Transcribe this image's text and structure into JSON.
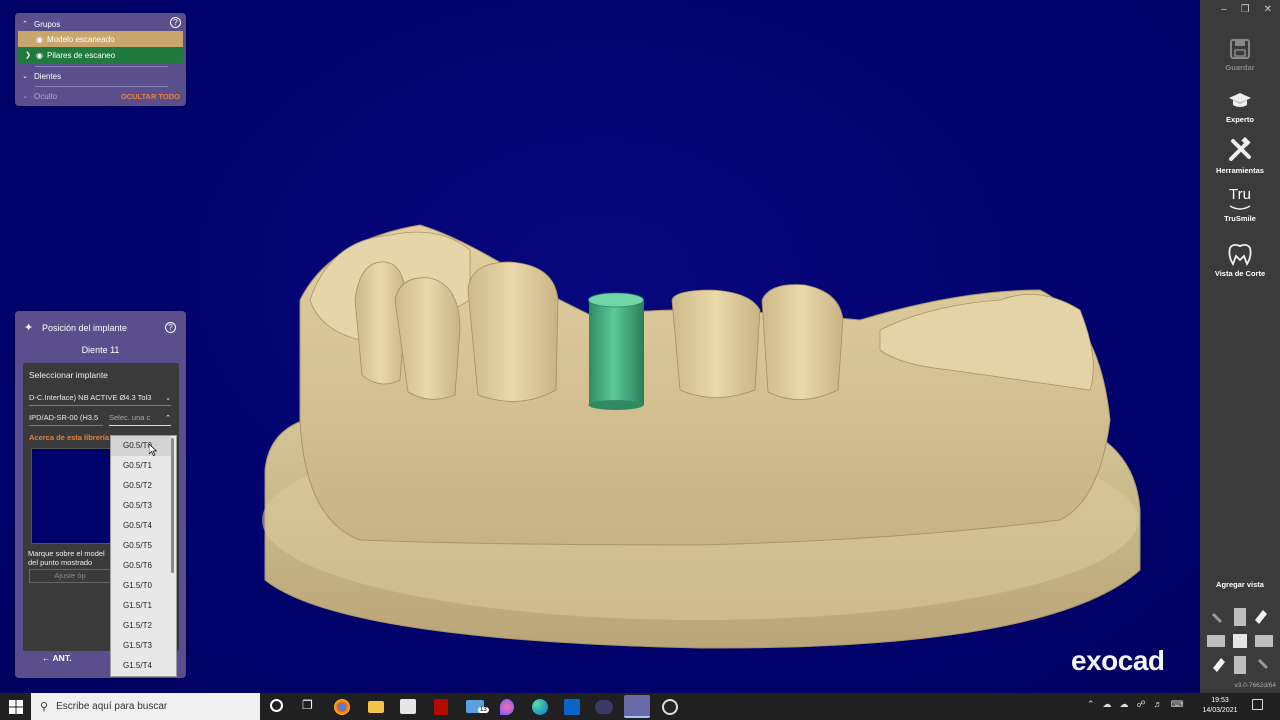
{
  "groups_panel": {
    "title": "Grupos",
    "items": [
      {
        "label": "Modelo escaneado",
        "color": "#c9a66b"
      },
      {
        "label": "Pilares de escaneo",
        "color": "#1f7a3e"
      }
    ],
    "teeth_label": "Dientes",
    "hidden_label": "Oculto",
    "hide_all_label": "OCULTAR TODO"
  },
  "implant_panel": {
    "title": "Posición del implante",
    "tooth": "Diente 11",
    "select_implant_label": "Seleccionar implante",
    "library_value": "D-C.Interface) NB ACTIVE Ø4.3 Tol3",
    "abutment_value": "IPD/AD-SR-00 (H3.5",
    "selection_placeholder": "Selec. una c",
    "about_link": "Acerca de esta librería",
    "instruction_line1": "Marque sobre el model",
    "instruction_line2": "del punto mostrado",
    "adjust_button": "Ajuste óp",
    "back_button": "ANT."
  },
  "dropdown": {
    "options": [
      "G0.5/T0",
      "G0.5/T1",
      "G0.5/T2",
      "G0.5/T3",
      "G0.5/T4",
      "G0.5/T5",
      "G0.5/T6",
      "G1.5/T0",
      "G1.5/T1",
      "G1.5/T2",
      "G1.5/T3",
      "G1.5/T4"
    ],
    "hovered_index": 0
  },
  "toolbar": {
    "save": "Guardar",
    "expert": "Experto",
    "tools": "Herramientas",
    "trusmile": "TruSmile",
    "trusmile_logo": "Tru",
    "cut_view": "Vista de Corte",
    "add_view": "Agregar vista",
    "version": "v3.0-7662d/64"
  },
  "brand": "exocad",
  "taskbar": {
    "search_placeholder": "Escribe aquí para buscar",
    "time": "19:53",
    "date": "14/03/2021",
    "mail_badge": "13"
  },
  "colors": {
    "background": "#00006e",
    "model": "#d9c69a",
    "scan_post": "#3aa97a",
    "panel": "#5a4f8c",
    "accent_orange": "#e8803a"
  }
}
